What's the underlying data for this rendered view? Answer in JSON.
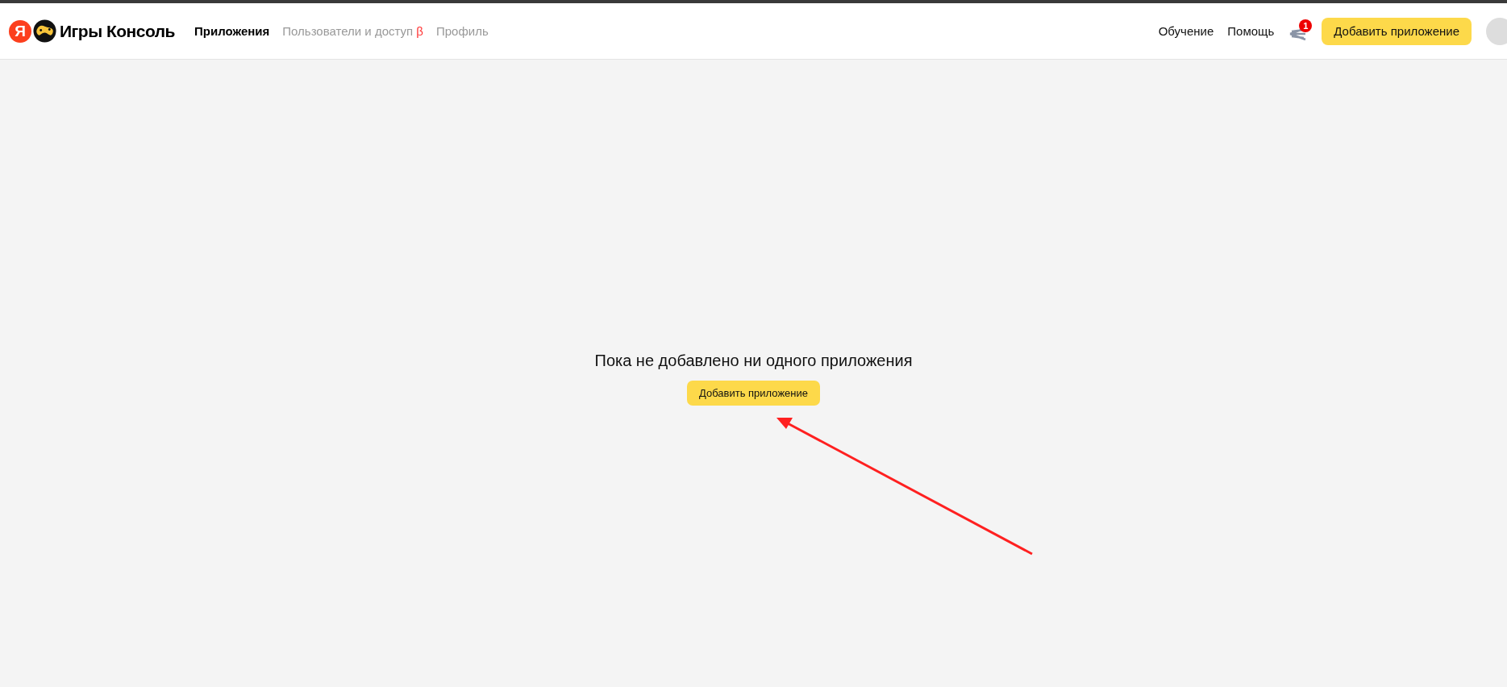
{
  "header": {
    "logo": {
      "letter": "Я",
      "title": "Игры Консоль"
    },
    "tabs": [
      {
        "label": "Приложения",
        "selected": true
      },
      {
        "label": "Пользователи и доступ",
        "selected": false,
        "mark": "β"
      },
      {
        "label": "Профиль",
        "selected": false
      }
    ],
    "links": [
      "Обучение",
      "Помощь"
    ],
    "notifications": {
      "count": "1"
    },
    "add_button": "Добавить приложение"
  },
  "empty_state": {
    "message": "Пока не добавлено ни одного приложения",
    "button": "Добавить приложение"
  },
  "annotation": {
    "kind": "arrow",
    "color": "#ff2020"
  }
}
